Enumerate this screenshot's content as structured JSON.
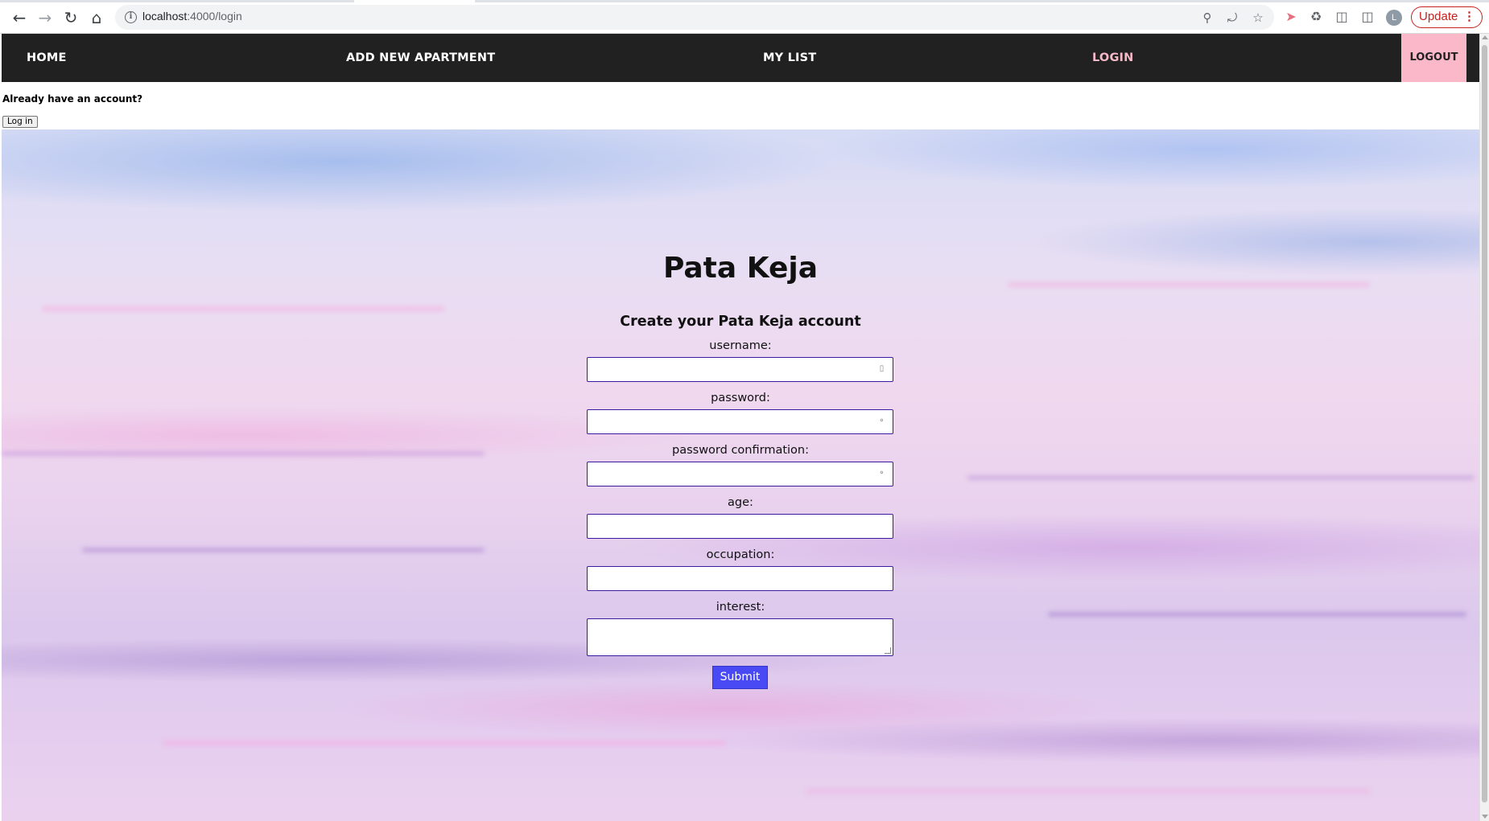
{
  "browser": {
    "url_host": "localhost",
    "url_path": ":4000/login",
    "update_label": "Update",
    "profile_initial": "L"
  },
  "navbar": {
    "home": "HOME",
    "add_apartment": "ADD NEW APARTMENT",
    "my_list": "MY LIST",
    "login": "LOGIN",
    "logout": "LOGOUT",
    "active_color": "#f7b9c7",
    "logout_bg": "#fbb8c8",
    "bar_color": "#212121"
  },
  "account_prompt": {
    "text": "Already have an account?",
    "login_button": "Log in"
  },
  "form": {
    "title": "Pata Keja",
    "subtitle": "Create your Pata Keja account",
    "fields": {
      "username": "username:",
      "password": "password:",
      "password_confirmation": "password confirmation:",
      "age": "age:",
      "occupation": "occupation:",
      "interest": "interest:"
    },
    "submit": "Submit",
    "submit_color": "#4a4af5",
    "input_border_color": "#3a1a9e"
  }
}
